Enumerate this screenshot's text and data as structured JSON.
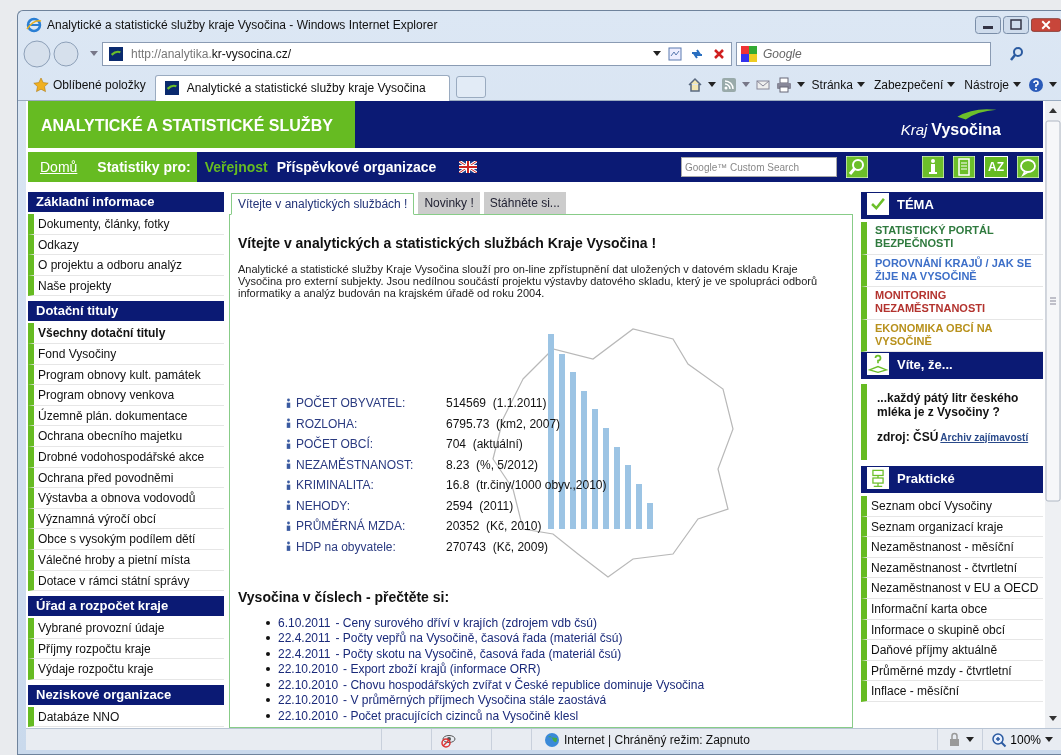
{
  "window": {
    "title": "Analytické a statistické služby kraje Vysočina - Windows Internet Explorer"
  },
  "address_bar": {
    "url_prefix": "http://analytika.",
    "url_domain": "kr-vysocina.cz/",
    "search_placeholder": "Google"
  },
  "favorites_bar": {
    "label": "Oblíbené položky",
    "tab": "Analytické a statistické služby kraje Vysočina",
    "menus": [
      "Stránka",
      "Zabezpečení",
      "Nástroje"
    ]
  },
  "page_header": {
    "title": "ANALYTICKÉ A STATISTICKÉ SLUŽBY",
    "logo_prefix": "Kraj",
    "logo_name": "Vysočina"
  },
  "nav": {
    "home": "Domů",
    "label": "Statistiky pro:",
    "audiences": [
      {
        "label": "Veřejnost",
        "selected": true
      },
      {
        "label": "Příspěvkové organizace",
        "selected": false
      }
    ],
    "search_placeholder": "Google™ Custom Search",
    "index_button": "AZ"
  },
  "left_sidebar": [
    {
      "title": "Základní informace",
      "items": [
        {
          "label": "Dokumenty, články, fotky",
          "selected": false
        },
        {
          "label": "Odkazy",
          "selected": false
        },
        {
          "label": "O projektu a odboru analýz",
          "selected": false
        },
        {
          "label": "Naše projekty",
          "selected": false
        }
      ]
    },
    {
      "title": "Dotační tituly",
      "items": [
        {
          "label": "Všechny dotační tituly",
          "selected": true
        },
        {
          "label": "Fond Vysočiny",
          "selected": false
        },
        {
          "label": "Program obnovy kult. památek",
          "selected": false
        },
        {
          "label": "Program obnovy venkova",
          "selected": false
        },
        {
          "label": "Územně plán. dokumentace",
          "selected": false
        },
        {
          "label": "Ochrana obecního majetku",
          "selected": false
        },
        {
          "label": "Drobné vodohospodářské akce",
          "selected": false
        },
        {
          "label": "Ochrana před povodněmi",
          "selected": false
        },
        {
          "label": "Výstavba a obnova vodovodů",
          "selected": false
        },
        {
          "label": "Významná výročí obcí",
          "selected": false
        },
        {
          "label": "Obce s vysokým podílem dětí",
          "selected": false
        },
        {
          "label": "Válečné hroby a pietní místa",
          "selected": false
        },
        {
          "label": "Dotace v rámci státní správy",
          "selected": false
        }
      ]
    },
    {
      "title": "Úřad a rozpočet kraje",
      "items": [
        {
          "label": "Vybrané provozní údaje",
          "selected": false
        },
        {
          "label": "Příjmy rozpočtu kraje",
          "selected": false
        },
        {
          "label": "Výdaje rozpočtu kraje",
          "selected": false
        }
      ]
    },
    {
      "title": "Neziskové organizace",
      "items": [
        {
          "label": "Databáze NNO",
          "selected": false
        }
      ]
    }
  ],
  "tabs": [
    {
      "label": "Vítejte v analytických službách !",
      "selected": true
    },
    {
      "label": "Novinky !",
      "selected": false
    },
    {
      "label": "Stáhněte si...",
      "selected": false
    }
  ],
  "intro": {
    "heading": "Vítejte v analytických a statistických službách Kraje Vysočina !",
    "text": "Analytické a statistické služby Kraje Vysočina slouží pro on-line zpřístupnění dat uložených v datovém skladu Kraje Vysočina pro externí subjekty. Jsou nedílnou součástí projektu výstavby datového skladu, který je ve spolupráci odborů informatiky a analýz budován na krajském úřadě od roku 2004."
  },
  "stats": [
    {
      "label": "POČET OBYVATEL:",
      "value": "514569  (1.1.2011)"
    },
    {
      "label": "ROZLOHA:",
      "value": "6795.73  (km2, 2007)"
    },
    {
      "label": "POČET OBCÍ:",
      "value": "704  (aktuální)"
    },
    {
      "label": "NEZAMĚSTNANOST:",
      "value": "8.23  (%, 5/2012)"
    },
    {
      "label": "KRIMINALITA:",
      "value": "16.8  (tr.činy/1000 obyv.,2010)"
    },
    {
      "label": "NEHODY:",
      "value": "2594  (2011)"
    },
    {
      "label": "PRŮMĚRNÁ MZDA:",
      "value": "20352  (Kč, 2010)"
    },
    {
      "label": "HDP na obyvatele:",
      "value": "270743  (Kč, 2009)"
    }
  ],
  "news_heading": "Vysočina v číslech - přečtěte si:",
  "news": [
    {
      "date": "6.10.2011",
      "title": "- Ceny surového dříví v krajích (zdrojem vdb čsú)"
    },
    {
      "date": "22.4.2011",
      "title": "- Počty vepřů na Vysočině, časová řada (materiál čsú)"
    },
    {
      "date": "22.4.2011",
      "title": "- Počty skotu na Vysočině, časová řada (materiál čsú)"
    },
    {
      "date": "22.10.2010",
      "title": "- Export zboží krajů (informace ORR)"
    },
    {
      "date": "22.10.2010",
      "title": "- Chovu hospodářských zvířat v České republice dominuje Vysočina"
    },
    {
      "date": "22.10.2010",
      "title": "- V průměrných příjmech Vysočina stále zaostává"
    },
    {
      "date": "22.10.2010",
      "title": "- Počet pracujících cizinců na Vysočině klesl"
    }
  ],
  "theme_box": {
    "title": "TÉMA",
    "items": [
      {
        "label": "STATISTICKÝ PORTÁL BEZPEČNOSTI",
        "color": "#2f7a3e"
      },
      {
        "label": "POROVNÁNÍ KRAJŮ / JAK SE ŽIJE NA VYSOČINĚ",
        "color": "#3d6fc8"
      },
      {
        "label": "MONITORING NEZAMĚSTNANOSTI",
        "color": "#b3332e"
      },
      {
        "label": "EKONOMIKA OBCÍ NA VYSOČINĚ",
        "color": "#b8911c"
      }
    ]
  },
  "fact_box": {
    "title": "Víte, že...",
    "text": "...každý pátý litr českého mléka je z Vysočiny ?",
    "source": "zdroj: ČSÚ",
    "link": "Archiv zajímavostí"
  },
  "practical_box": {
    "title": "Praktické",
    "items": [
      "Seznam obcí Vysočiny",
      "Seznam organizací kraje",
      "Nezaměstnanost - měsíční",
      "Nezaměstnanost - čtvrtletní",
      "Nezaměstnanost v EU a OECD",
      "Informační karta obce",
      "Informace o skupině obcí",
      "Daňové příjmy aktuálně",
      "Průměrné mzdy - čtvrtletní",
      "Inflace - měsíční"
    ]
  },
  "status_bar": {
    "zone": "Internet | Chráněný režim: Zapnuto",
    "zoom": "100%"
  }
}
